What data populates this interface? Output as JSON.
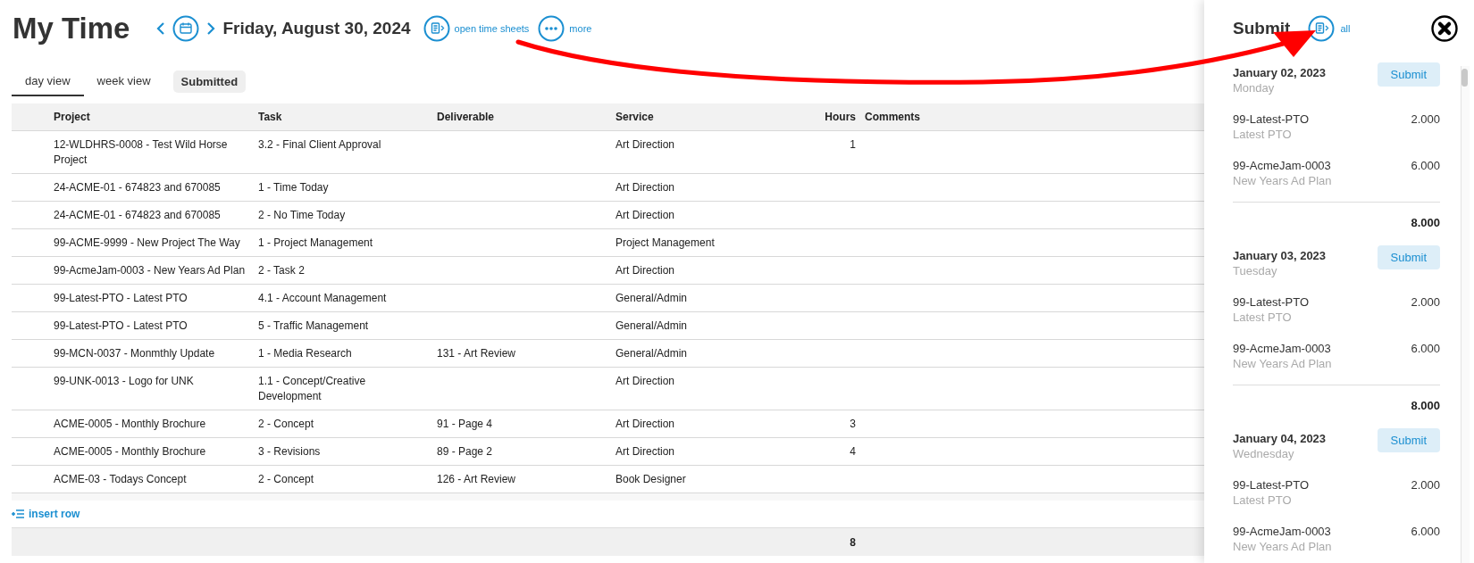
{
  "header": {
    "title": "My Time",
    "date": "Friday, August 30, 2024",
    "actions": [
      {
        "kind": "timesheet",
        "label": "open time sheets"
      },
      {
        "kind": "more",
        "label": "more"
      }
    ]
  },
  "tabs": [
    {
      "kind": "tab",
      "label": "day view",
      "selected": true
    },
    {
      "kind": "tab",
      "label": "week view",
      "selected": false
    },
    {
      "kind": "chip",
      "label": "Submitted",
      "selected": false
    }
  ],
  "table": {
    "columns": [
      {
        "label": "Project"
      },
      {
        "label": "Task"
      },
      {
        "label": "Deliverable"
      },
      {
        "label": "Service"
      },
      {
        "label": "Hours"
      },
      {
        "label": "Comments"
      }
    ],
    "rows": [
      {
        "project": "12-WLDHRS-0008 - Test Wild Horse Project",
        "task": "3.2 - Final Client Approval",
        "service": "Art Direction",
        "hours": "1"
      },
      {
        "project": "24-ACME-01 - 674823 and 670085",
        "task": "1 - Time Today",
        "service": "Art Direction"
      },
      {
        "project": "24-ACME-01 - 674823 and 670085",
        "task": "2 - No Time Today",
        "service": "Art Direction"
      },
      {
        "project": "99-ACME-9999 - New Project The Way",
        "task": "1 - Project Management",
        "service": "Project Management"
      },
      {
        "project": "99-AcmeJam-0003 - New Years Ad Plan",
        "task": "2 - Task 2",
        "service": "Art Direction"
      },
      {
        "project": "99-Latest-PTO - Latest PTO",
        "task": "4.1 - Account Management",
        "service": "General/Admin"
      },
      {
        "project": "99-Latest-PTO - Latest PTO",
        "task": "5 - Traffic Management",
        "service": "General/Admin"
      },
      {
        "project": "99-MCN-0037 - Monmthly Update",
        "task": "1 - Media Research",
        "deliverable": "131 - Art Review",
        "service": "General/Admin"
      },
      {
        "project": "99-UNK-0013 - Logo for UNK",
        "task": "1.1 - Concept/Creative Development",
        "service": "Art Direction"
      },
      {
        "project": "ACME-0005 - Monthly Brochure",
        "task": "2 - Concept",
        "deliverable": "91 - Page 4",
        "service": "Art Direction",
        "hours": "3"
      },
      {
        "project": "ACME-0005 - Monthly Brochure",
        "task": "3 - Revisions",
        "deliverable": "89 - Page 2",
        "service": "Art Direction",
        "hours": "4"
      },
      {
        "project": "ACME-03 - Todays Concept",
        "task": "2 - Concept",
        "deliverable": "126 - Art Review",
        "service": "Book Designer"
      }
    ],
    "insert_label": "insert row",
    "total_hours": "8"
  },
  "submit_panel": {
    "title": "Submit",
    "all_label": "all",
    "days": [
      {
        "date": "January 02, 2023",
        "weekday": "Monday",
        "button": "Submit",
        "entries": [
          {
            "code": "99-Latest-PTO",
            "name": "Latest PTO",
            "hours": "2.000"
          },
          {
            "code": "99-AcmeJam-0003",
            "name": "New Years Ad Plan",
            "hours": "6.000"
          }
        ],
        "total": "8.000"
      },
      {
        "date": "January 03, 2023",
        "weekday": "Tuesday",
        "button": "Submit",
        "entries": [
          {
            "code": "99-Latest-PTO",
            "name": "Latest PTO",
            "hours": "2.000"
          },
          {
            "code": "99-AcmeJam-0003",
            "name": "New Years Ad Plan",
            "hours": "6.000"
          }
        ],
        "total": "8.000"
      },
      {
        "date": "January 04, 2023",
        "weekday": "Wednesday",
        "button": "Submit",
        "entries": [
          {
            "code": "99-Latest-PTO",
            "name": "Latest PTO",
            "hours": "2.000"
          },
          {
            "code": "99-AcmeJam-0003",
            "name": "New Years Ad Plan",
            "hours": "6.000"
          }
        ]
      }
    ]
  }
}
